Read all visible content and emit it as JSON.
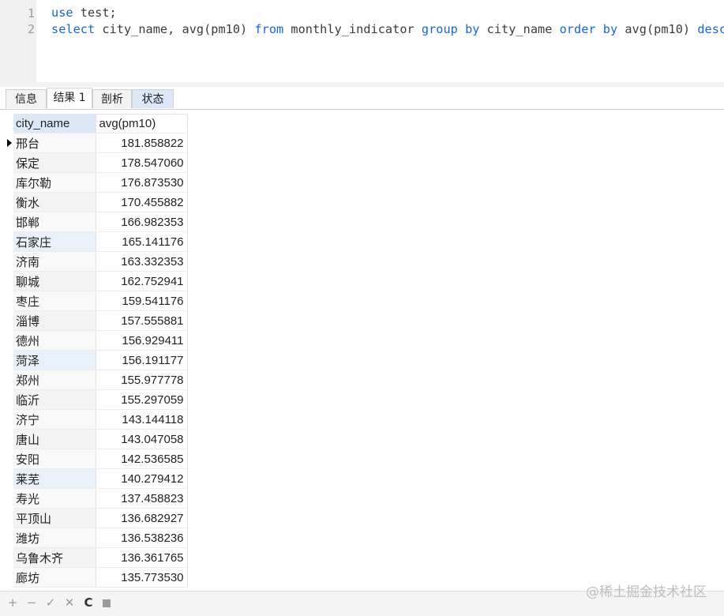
{
  "editor": {
    "line_numbers": [
      "1",
      "2"
    ],
    "line1": {
      "kw1": "use",
      "rest": " test;"
    },
    "line2": {
      "kw_select": "select",
      "t1": " city_name, avg(pm10) ",
      "kw_from": "from",
      "t2": " monthly_indicator ",
      "kw_group": "group",
      "sp1": " ",
      "kw_by1": "by",
      "t3": " city_name ",
      "kw_order": "order",
      "sp2": " ",
      "kw_by2": "by",
      "t4": " avg(pm10) ",
      "kw_desc": "desc",
      "t5": ";"
    }
  },
  "tabs": [
    "信息",
    "结果 1",
    "剖析",
    "状态"
  ],
  "grid": {
    "columns": [
      "city_name",
      "avg(pm10)"
    ],
    "rows": [
      [
        "邢台",
        "181.858822"
      ],
      [
        "保定",
        "178.547060"
      ],
      [
        "库尔勒",
        "176.873530"
      ],
      [
        "衡水",
        "170.455882"
      ],
      [
        "邯郸",
        "166.982353"
      ],
      [
        "石家庄",
        "165.141176"
      ],
      [
        "济南",
        "163.332353"
      ],
      [
        "聊城",
        "162.752941"
      ],
      [
        "枣庄",
        "159.541176"
      ],
      [
        "淄博",
        "157.555881"
      ],
      [
        "德州",
        "156.929411"
      ],
      [
        "菏泽",
        "156.191177"
      ],
      [
        "郑州",
        "155.977778"
      ],
      [
        "临沂",
        "155.297059"
      ],
      [
        "济宁",
        "143.144118"
      ],
      [
        "唐山",
        "143.047058"
      ],
      [
        "安阳",
        "142.536585"
      ],
      [
        "莱芜",
        "140.279412"
      ],
      [
        "寿光",
        "137.458823"
      ],
      [
        "平顶山",
        "136.682927"
      ],
      [
        "潍坊",
        "136.538236"
      ],
      [
        "乌鲁木齐",
        "136.361765"
      ],
      [
        "廊坊",
        "135.773530"
      ]
    ]
  },
  "toolbar": {
    "add": "+",
    "remove": "−",
    "apply": "✓",
    "cancel": "✕",
    "refresh": "C"
  },
  "watermark": "@稀土掘金技术社区"
}
